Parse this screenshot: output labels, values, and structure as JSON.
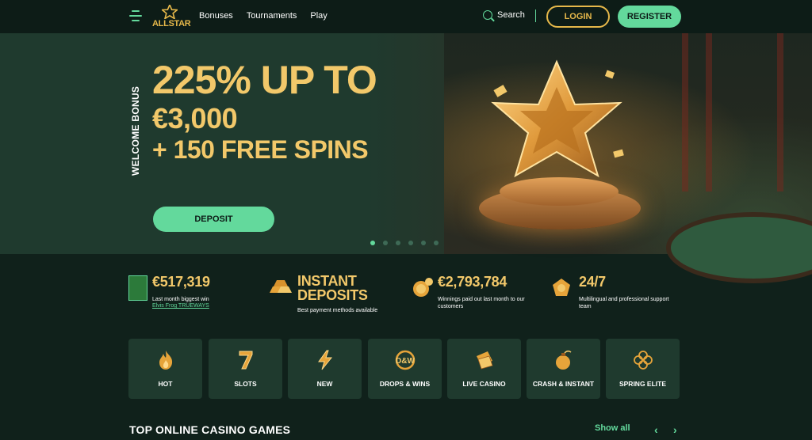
{
  "header": {
    "logo_text": "ALLSTAR",
    "nav": [
      "Bonuses",
      "Tournaments",
      "Play"
    ],
    "search_label": "Search",
    "login_label": "LOGIN",
    "register_label": "REGISTER"
  },
  "hero": {
    "side_label": "WELCOME BONUS",
    "line1": "225% UP TO",
    "line2": "€3,000",
    "line3": "+ 150 FREE SPINS",
    "cta_label": "DEPOSIT",
    "slide_count": 6,
    "active_slide": 1
  },
  "stats": [
    {
      "value": "€517,319",
      "desc": "Last month biggest win",
      "link": "Elvis Frog TRUEWAYS"
    },
    {
      "value": "INSTANT DEPOSITS",
      "desc": "Best payment methods available"
    },
    {
      "value": "€2,793,784",
      "desc": "Winnings paid out last month to our customers"
    },
    {
      "value": "24/7",
      "desc": "Multilingual and professional support team"
    }
  ],
  "categories": [
    {
      "label": "HOT",
      "icon": "flame-icon"
    },
    {
      "label": "SLOTS",
      "icon": "seven-icon"
    },
    {
      "label": "NEW",
      "icon": "lightning-icon"
    },
    {
      "label": "DROPS & WINS",
      "icon": "drops-wins-icon"
    },
    {
      "label": "LIVE CASINO",
      "icon": "cards-icon"
    },
    {
      "label": "CRASH & INSTANT",
      "icon": "bomb-icon"
    },
    {
      "label": "SPRING ELITE",
      "icon": "clover-icon"
    }
  ],
  "section": {
    "title": "TOP ONLINE CASINO GAMES",
    "show_all": "Show all",
    "prev": "‹",
    "next": "›"
  },
  "colors": {
    "accent": "#63d99c",
    "gold": "#f2c86a",
    "background": "#10211b",
    "card": "#1f3a2e"
  }
}
